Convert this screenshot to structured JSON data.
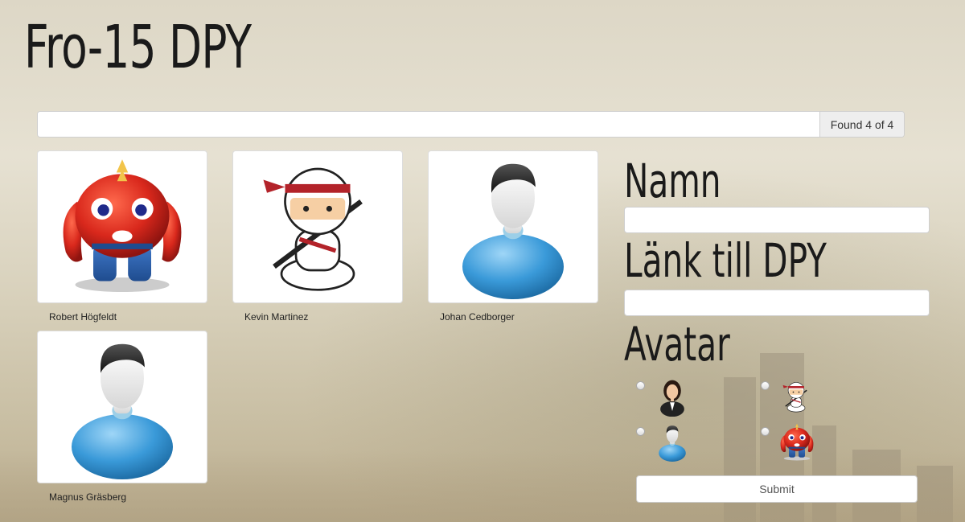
{
  "site": {
    "title": "Fro-15 DPY"
  },
  "search": {
    "value": "",
    "placeholder": "",
    "count_text": "Found 4 of 4"
  },
  "people": [
    {
      "name": "Robert Högfeldt",
      "avatar": "red-monster-avatar"
    },
    {
      "name": "Kevin Martinez",
      "avatar": "ninja-avatar"
    },
    {
      "name": "Johan Cedborger",
      "avatar": "default-user-avatar"
    },
    {
      "name": "Magnus Gräsberg",
      "avatar": "default-user-avatar"
    }
  ],
  "form": {
    "name_label": "Namn",
    "name_value": "",
    "link_label": "Länk till DPY",
    "link_value": "",
    "avatar_label": "Avatar",
    "avatar_options": [
      "businesswoman-avatar",
      "ninja-avatar",
      "default-user-avatar",
      "red-monster-avatar"
    ],
    "submit_label": "Submit"
  },
  "colors": {
    "monster_red": "#d9281c",
    "user_blue": "#3a9ad9",
    "ninja_red": "#b3232a"
  }
}
